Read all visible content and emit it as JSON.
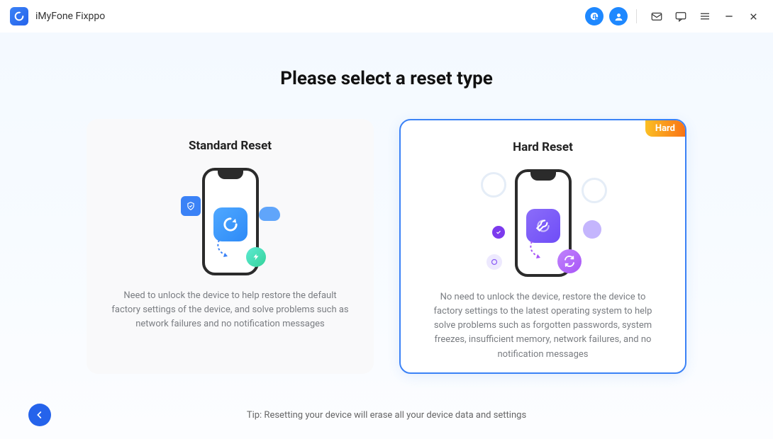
{
  "app": {
    "title": "iMyFone Fixppo"
  },
  "page": {
    "heading": "Please select a reset type",
    "footer_tip": "Tip: Resetting your device will erase all your device data and settings"
  },
  "cards": {
    "standard": {
      "title": "Standard Reset",
      "description": "Need to unlock the device to help restore the default factory settings of the device, and solve problems such as network failures and no notification messages"
    },
    "hard": {
      "title": "Hard Reset",
      "badge": "Hard",
      "description": "No need to unlock the device, restore the device to factory settings to the latest operating system to help solve problems such as forgotten passwords, system freezes, insufficient memory, network failures, and no notification messages"
    }
  }
}
